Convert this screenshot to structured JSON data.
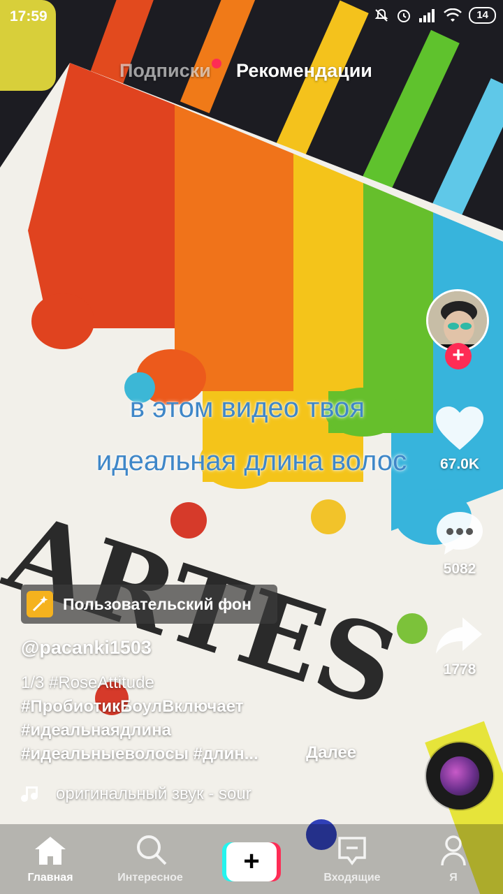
{
  "status_bar": {
    "time": "17:59",
    "battery": "14"
  },
  "top_tabs": {
    "following": "Подписки",
    "for_you": "Рекомендации"
  },
  "video_caption": {
    "line1": "в этом видео твоя",
    "line2": "идеальная длина волос"
  },
  "actions": {
    "likes": "67.0K",
    "comments": "5082",
    "shares": "1778"
  },
  "effect": {
    "label": "Пользовательский фон"
  },
  "author": {
    "username": "@pacanki1503"
  },
  "description": {
    "line1": "1/3 #RoseAttitude",
    "line2": "#ПробиотикБоулВключает",
    "line3": "#идеальнаядлина",
    "line4": "#идеальныеволосы #длин...",
    "more": "Далее"
  },
  "music": {
    "title": "оригинальный звук - sour"
  },
  "bottom_nav": {
    "home": "Главная",
    "explore": "Интересное",
    "inbox": "Входящие",
    "me": "Я"
  },
  "colors": {
    "accent_red": "#fe2c55",
    "accent_cyan": "#25f4ee",
    "caption_blue": "#3f87c8"
  }
}
